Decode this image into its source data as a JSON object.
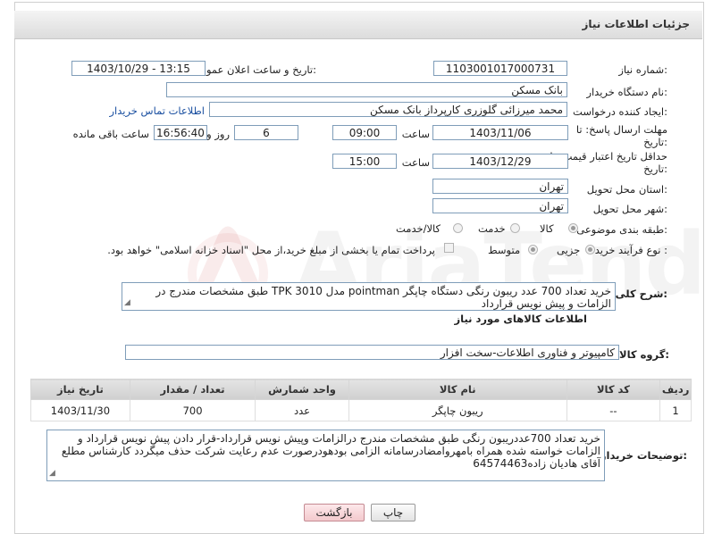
{
  "header": {
    "title": "جزئیات اطلاعات نیاز"
  },
  "fields": {
    "need_number": {
      "label": "شماره نیاز:",
      "value": "1103001017000731"
    },
    "announce_datetime": {
      "label": "تاریخ و ساعت اعلان عمومی:",
      "value": "1403/10/29 - 13:15"
    },
    "buyer_org": {
      "label": "نام دستگاه خریدار:",
      "value": "بانک مسکن"
    },
    "requester": {
      "label": "ایجاد کننده درخواست:",
      "value": "محمد میرزائی گلوزری کارپرداز بانک مسکن",
      "contact_link": "اطلاعات تماس خریدار"
    },
    "reply_deadline": {
      "label_line1": "مهلت ارسال پاسخ: تا",
      "label_line2": "تاریخ:",
      "date": "1403/11/06",
      "time_label": "ساعت",
      "time": "09:00",
      "days": "6",
      "days_label": "روز و",
      "remaining": "16:56:40",
      "remaining_label": "ساعت باقی مانده"
    },
    "price_validity": {
      "label_line1": "حداقل تاریخ اعتبار قیمت: تا",
      "label_line2": "تاریخ:",
      "date": "1403/12/29",
      "time_label": "ساعت",
      "time": "15:00"
    },
    "province": {
      "label": "استان محل تحویل:",
      "value": "تهران"
    },
    "city": {
      "label": "شهر محل تحویل:",
      "value": "تهران"
    },
    "category": {
      "label": "طبقه بندی موضوعی:",
      "options": [
        "کالا",
        "خدمت",
        "کالا/خدمت"
      ],
      "selected": "کالا"
    },
    "purchase_process": {
      "label": "نوع فرآیند خرید :",
      "options": [
        "جزیی",
        "متوسط"
      ],
      "selected": "جزیی",
      "payment_note": "پرداخت تمام یا بخشی از مبلغ خرید،از محل \"اسناد خزانه اسلامی\" خواهد بود."
    },
    "general_description": {
      "label": "شرح کلی نیاز:",
      "value": "خرید تعداد 700 عدد ریبون رنگی دستگاه چاپگر pointman  مدل TPK 3010 طبق مشخصات مندرج در الزامات و پیش نویس قرارداد"
    }
  },
  "goods_section": {
    "title": "اطلاعات کالاهای مورد نیاز",
    "group_label": "گروه کالا:",
    "group_value": "کامپیوتر و فناوری اطلاعات-سخت افزار"
  },
  "table": {
    "columns": [
      "ردیف",
      "کد کالا",
      "نام کالا",
      "واحد شمارش",
      "تعداد / مقدار",
      "تاریخ نیاز"
    ],
    "rows": [
      [
        "1",
        "--",
        "ریبون چاپگر",
        "عدد",
        "700",
        "1403/11/30"
      ]
    ]
  },
  "buyer_notes": {
    "label": "توضیحات خریدار:",
    "value": "خرید تعداد 700عددریبون رنگی طبق مشخصات مندرج درالزامات وپیش نویس قرارداد-قرار دادن پیش نویس قرارداد و الزامات خواسته شده همراه بامهروامضادرسامانه الزامی بودهودرصورت عدم رعایت شرکت حذف میگردد کارشناس مطلع آقای هادیان زاده64574463"
  },
  "buttons": {
    "print": "چاپ",
    "back": "بازگشت"
  },
  "watermark": {
    "text": "AriaTender.neT"
  }
}
